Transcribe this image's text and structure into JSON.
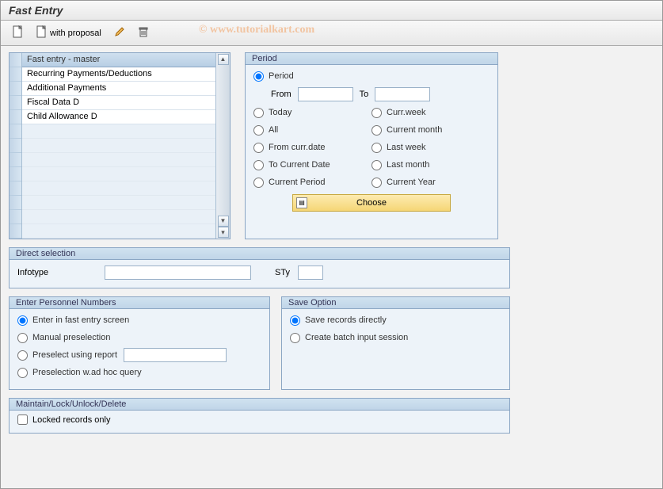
{
  "title": "Fast Entry",
  "watermark": "©  www.tutorialkart.com",
  "toolbar": {
    "proposal_label": "with proposal"
  },
  "list": {
    "header": "Fast entry - master",
    "items": [
      "Recurring Payments/Deductions",
      "Additional Payments",
      "Fiscal Data  D",
      "Child Allowance  D"
    ]
  },
  "period": {
    "title": "Period",
    "opts": {
      "period": "Period",
      "from": "From",
      "to": "To",
      "today": "Today",
      "currweek": "Curr.week",
      "all": "All",
      "currmonth": "Current month",
      "fromcurr": "From curr.date",
      "lastweek": "Last week",
      "tocurrent": "To Current Date",
      "lastmonth": "Last month",
      "currperiod": "Current Period",
      "curryear": "Current Year"
    },
    "choose": "Choose"
  },
  "direct": {
    "title": "Direct selection",
    "infotype_label": "Infotype",
    "sty_label": "STy"
  },
  "personnel": {
    "title": "Enter Personnel Numbers",
    "opts": {
      "fast": "Enter in fast entry screen",
      "manual": "Manual preselection",
      "report": "Preselect using report",
      "adhoc": "Preselection w.ad hoc query"
    }
  },
  "save": {
    "title": "Save Option",
    "opts": {
      "direct": "Save records directly",
      "batch": "Create batch input session"
    }
  },
  "maintain": {
    "title": "Maintain/Lock/Unlock/Delete",
    "locked": "Locked records only"
  }
}
